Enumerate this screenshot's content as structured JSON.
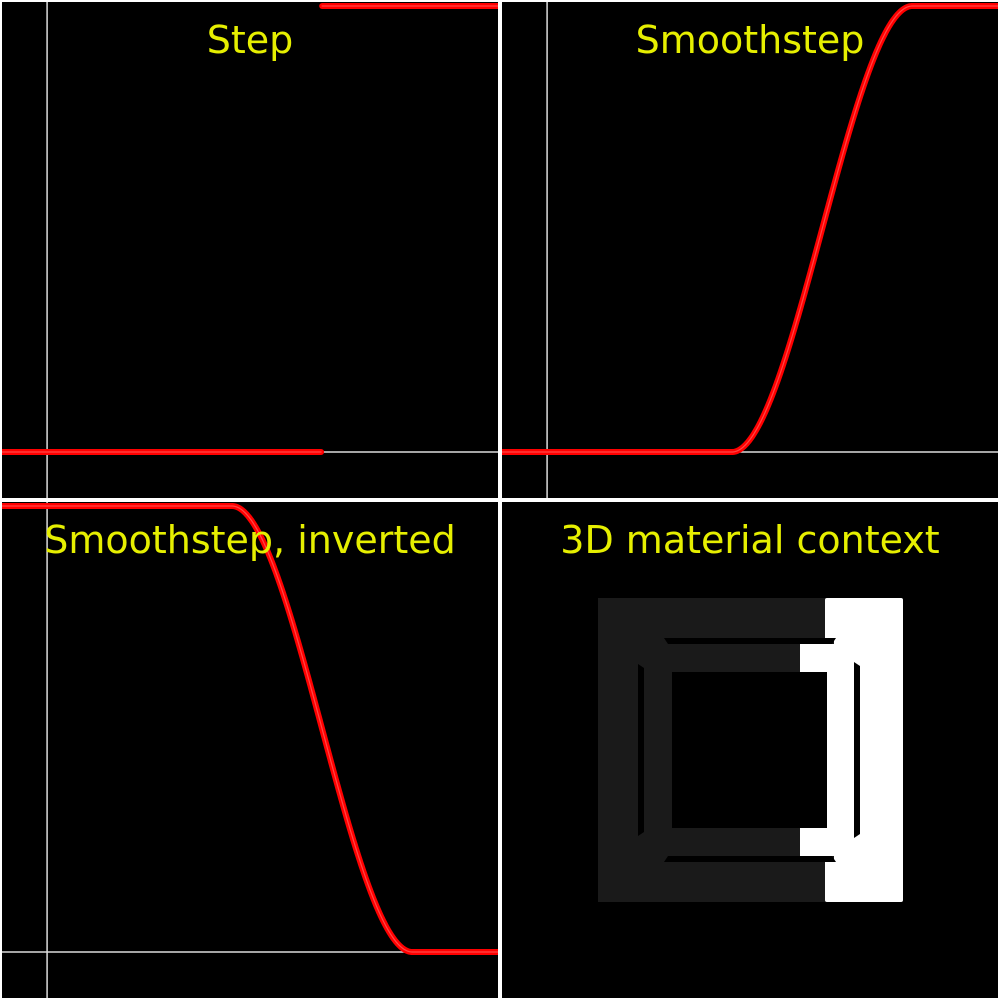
{
  "panels": [
    {
      "id": "step",
      "title": "Step"
    },
    {
      "id": "smoothstep",
      "title": "Smoothstep"
    },
    {
      "id": "smoothstep-inverted",
      "title": "Smoothstep, inverted"
    },
    {
      "id": "material",
      "title": "3D material context"
    }
  ],
  "colors": {
    "background": "#000000",
    "separator": "#ffffff",
    "title": "#e6ef00",
    "curve": "#ff0000",
    "axis": "#dcdcdc",
    "material_dark": "#1a1a1a",
    "material_light": "#ffffff"
  },
  "chart_data": [
    {
      "type": "line",
      "title": "Step",
      "function": "step",
      "edge": 0.61,
      "xlim": [
        -0.1,
        1.0
      ],
      "ylim": [
        0.0,
        1.0
      ],
      "grid": false
    },
    {
      "type": "line",
      "title": "Smoothstep",
      "function": "smoothstep",
      "edge0": 0.41,
      "edge1": 0.81,
      "xlim": [
        -0.1,
        1.0
      ],
      "ylim": [
        0.0,
        1.0
      ],
      "grid": false
    },
    {
      "type": "line",
      "title": "Smoothstep, inverted",
      "function": "smoothstep-inverted",
      "edge0": 0.41,
      "edge1": 0.81,
      "xlim": [
        -0.1,
        1.0
      ],
      "ylim": [
        0.0,
        1.0
      ],
      "grid": false
    }
  ]
}
